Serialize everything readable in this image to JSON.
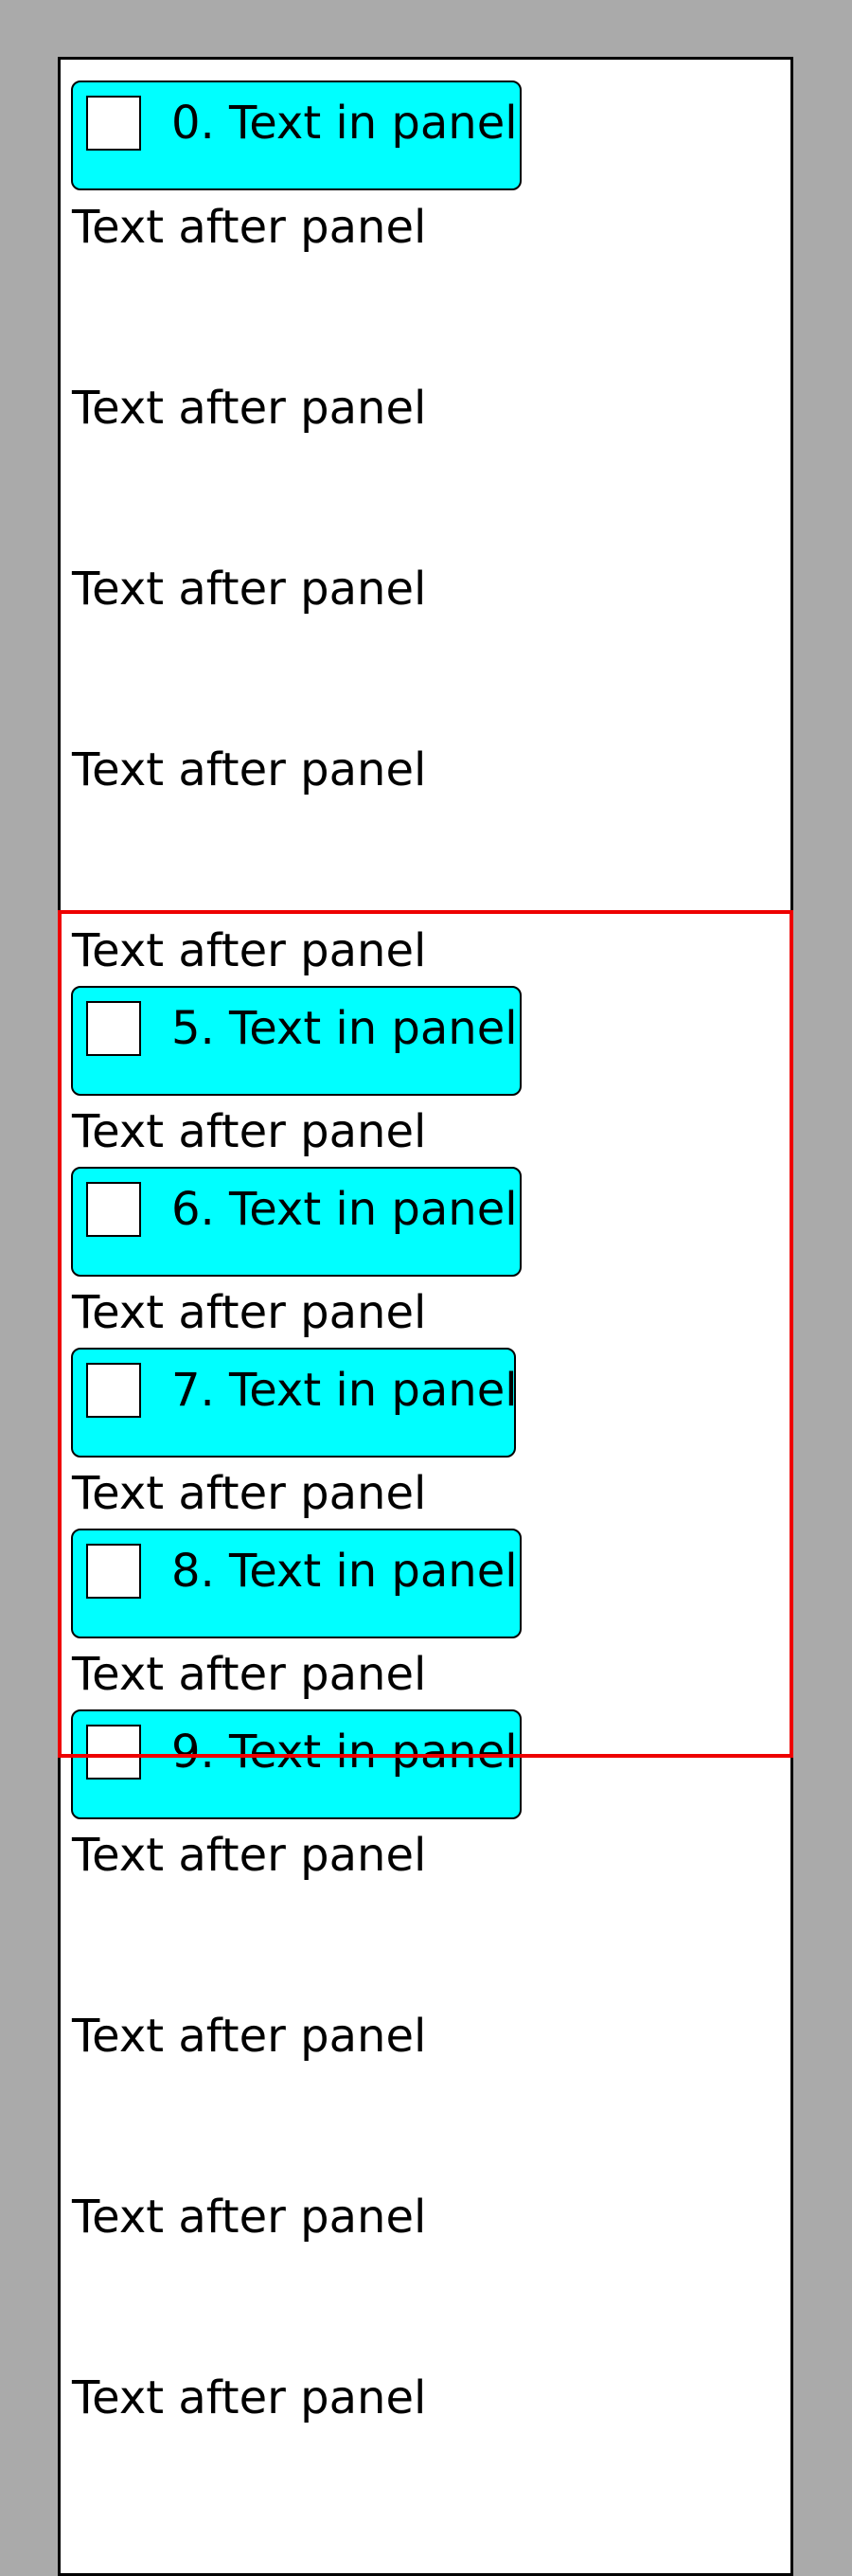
{
  "panels": [
    {
      "label": "0. Text in panel"
    },
    {
      "label": "5. Text in panel"
    },
    {
      "label": "6. Text in panel"
    },
    {
      "label": "7. Text in panel"
    },
    {
      "label": "8. Text in panel"
    },
    {
      "label": "9. Text in panel"
    }
  ],
  "after_panel_text": "Text after panel",
  "colors": {
    "panel": "#00ffff",
    "highlight": "#ee0000",
    "background": "#aaaaaa"
  }
}
